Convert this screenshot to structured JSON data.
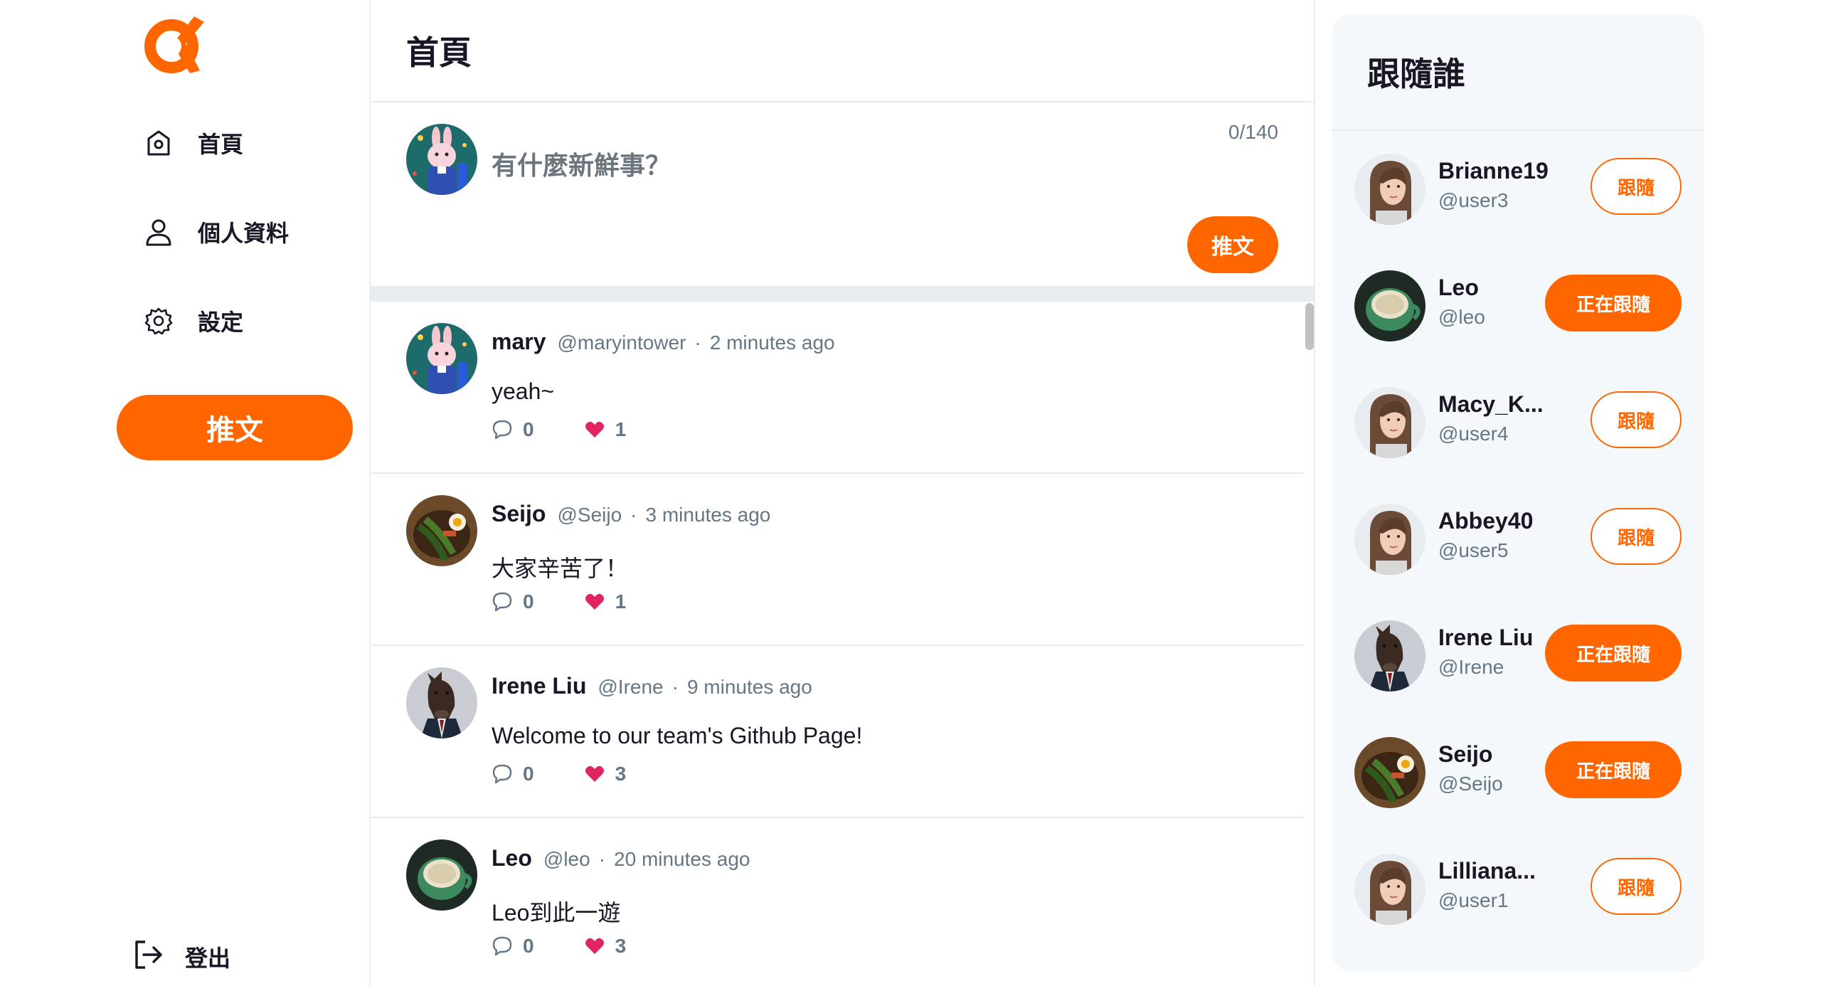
{
  "nav": {
    "items": [
      {
        "label": "首頁",
        "icon": "home-icon"
      },
      {
        "label": "個人資料",
        "icon": "user-icon"
      },
      {
        "label": "設定",
        "icon": "gear-icon"
      }
    ],
    "tweet_button": "推文",
    "logout_label": "登出",
    "brand_color": "#ff6600"
  },
  "main": {
    "title": "首頁",
    "composer": {
      "placeholder": "有什麼新鮮事？",
      "counter": "0/140",
      "submit_label": "推文"
    },
    "tweets": [
      {
        "name": "mary",
        "handle": "@maryintower",
        "separator": "·",
        "time": "2 minutes ago",
        "body": "yeah~",
        "replies": "0",
        "likes": "1",
        "avatar": "rabbit"
      },
      {
        "name": "Seijo",
        "handle": "@Seijo",
        "separator": "·",
        "time": "3 minutes ago",
        "body": "大家辛苦了！",
        "replies": "0",
        "likes": "1",
        "avatar": "food"
      },
      {
        "name": "Irene Liu",
        "handle": "@Irene",
        "separator": "·",
        "time": "9 minutes ago",
        "body": "Welcome to our team's Github Page!",
        "replies": "0",
        "likes": "3",
        "avatar": "horse"
      },
      {
        "name": "Leo",
        "handle": "@leo",
        "separator": "·",
        "time": "20 minutes ago",
        "body": "Leo到此一遊",
        "replies": "0",
        "likes": "3",
        "avatar": "cup"
      }
    ]
  },
  "follow": {
    "title": "跟隨誰",
    "users": [
      {
        "name": "Brianne19",
        "handle": "@user3",
        "button": "跟隨",
        "following": false,
        "avatar": "woman"
      },
      {
        "name": "Leo",
        "handle": "@leo",
        "button": "正在跟隨",
        "following": true,
        "avatar": "cup"
      },
      {
        "name": "Macy_K...",
        "handle": "@user4",
        "button": "跟隨",
        "following": false,
        "avatar": "woman"
      },
      {
        "name": "Abbey40",
        "handle": "@user5",
        "button": "跟隨",
        "following": false,
        "avatar": "woman"
      },
      {
        "name": "Irene Liu",
        "handle": "@Irene",
        "button": "正在跟隨",
        "following": true,
        "avatar": "horse"
      },
      {
        "name": "Seijo",
        "handle": "@Seijo",
        "button": "正在跟隨",
        "following": true,
        "avatar": "food"
      },
      {
        "name": "Lilliana...",
        "handle": "@user1",
        "button": "跟隨",
        "following": false,
        "avatar": "woman"
      }
    ]
  }
}
